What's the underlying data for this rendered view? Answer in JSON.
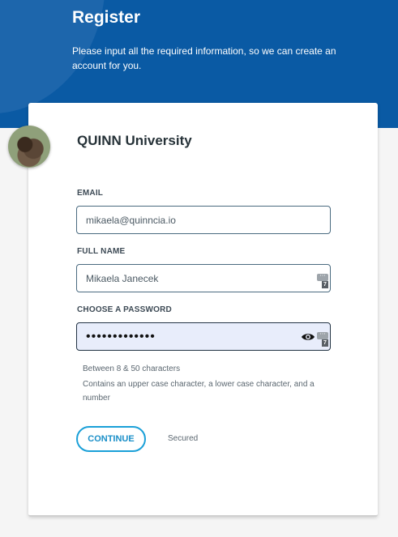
{
  "header": {
    "title": "Register",
    "subtitle": "Please input all the required information, so we can create an account for you."
  },
  "card": {
    "university_name": "QUINN University"
  },
  "form": {
    "email": {
      "label": "EMAIL",
      "value": "mikaela@quinncia.io"
    },
    "full_name": {
      "label": "FULL NAME",
      "value": "Mikaela Janecek"
    },
    "password": {
      "label": "CHOOSE A PASSWORD",
      "value": "•••••••••••••"
    },
    "password_hints": [
      "Between 8 & 50 characters",
      "Contains an upper case character, a lower case character, and a number"
    ],
    "keypass_badge": "7"
  },
  "actions": {
    "continue_label": "CONTINUE",
    "secured_label": "Secured"
  },
  "colors": {
    "header_bg": "#0a5aa4",
    "accent": "#1aa0d8",
    "password_bg": "#e8edfb"
  },
  "icons": {
    "password_toggle": "eye-icon",
    "password_manager": "keypass-icon"
  }
}
